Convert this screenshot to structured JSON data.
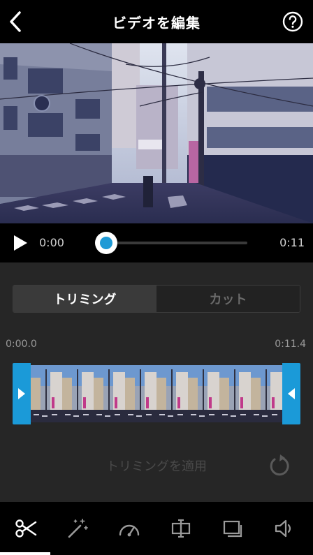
{
  "header": {
    "title": "ビデオを編集"
  },
  "player": {
    "current_time": "0:00",
    "total_time": "0:11",
    "progress": 0
  },
  "panel": {
    "tabs": [
      {
        "label": "トリミング",
        "active": true
      },
      {
        "label": "カット",
        "active": false
      }
    ],
    "trim_start": "0:00.0",
    "trim_end": "0:11.4",
    "apply_label": "トリミングを適用"
  },
  "toolbar": {
    "tools": [
      "scissors-icon",
      "magic-wand-icon",
      "speed-gauge-icon",
      "split-icon",
      "frame-icon",
      "speaker-icon"
    ],
    "active_index": 0
  },
  "colors": {
    "accent": "#1b9ad8",
    "panel": "#262626",
    "background": "#000000"
  }
}
